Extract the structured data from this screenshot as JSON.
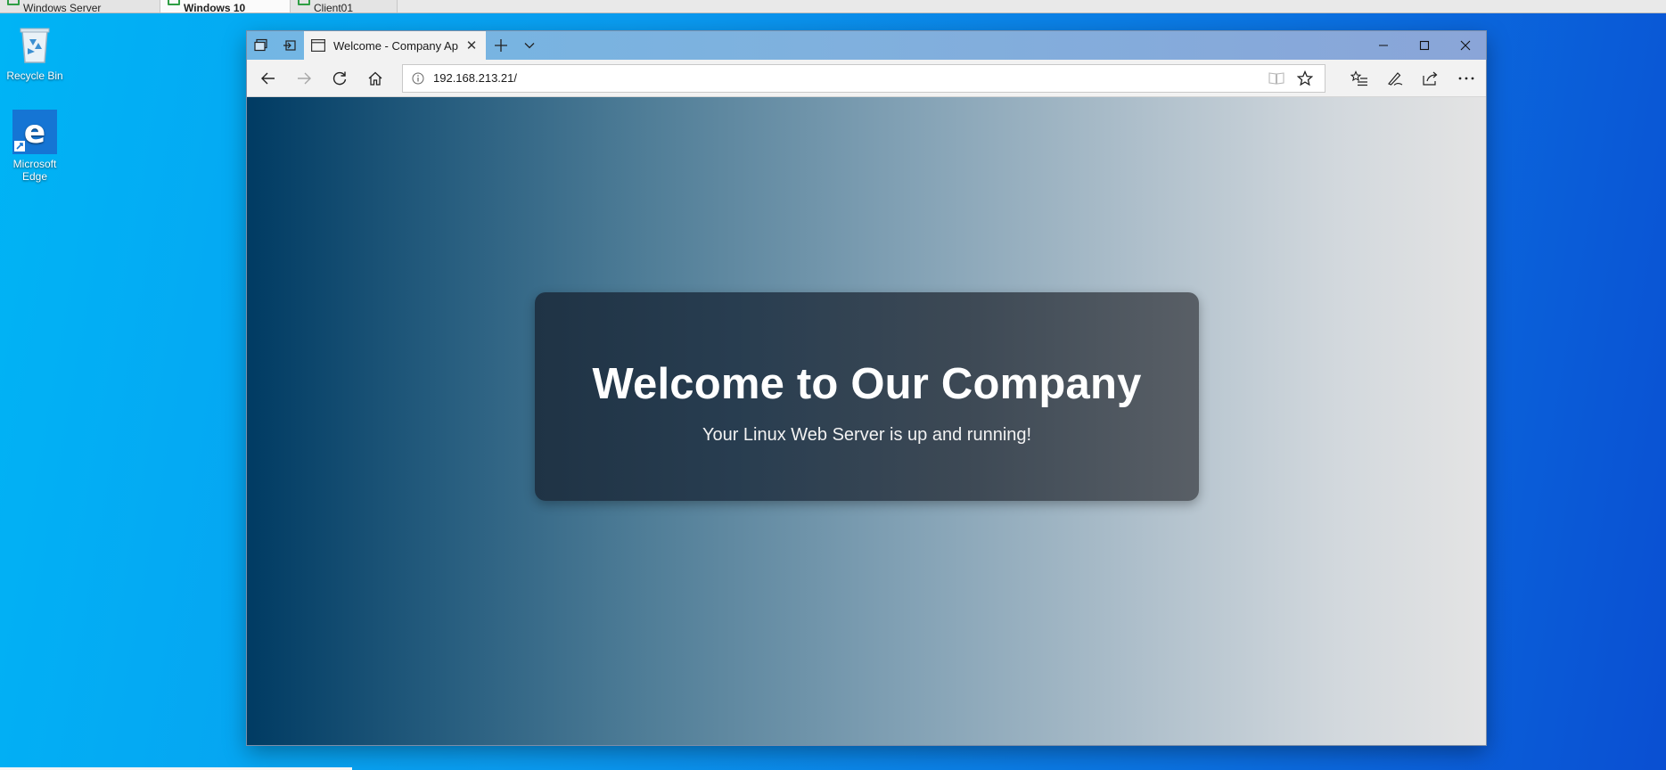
{
  "vm_tabs": [
    {
      "label": "Windows Server",
      "active": false
    },
    {
      "label": "Windows 10",
      "active": true
    },
    {
      "label": "Client01",
      "active": false
    }
  ],
  "desktop": {
    "icons": [
      {
        "label": "Recycle Bin",
        "icon": "recycle-bin-icon"
      },
      {
        "label": "Microsoft Edge",
        "icon": "edge-icon"
      }
    ]
  },
  "browser": {
    "tab_title": "Welcome - Company Ap",
    "address": "192.168.213.21/"
  },
  "page": {
    "heading": "Welcome to Our Company",
    "subheading": "Your Linux Web Server is up and running!"
  },
  "colors": {
    "desktop_accent": "#0a9cf0",
    "gradient_start": "#003b63",
    "gradient_end": "#e4e4e4",
    "card_bg": "#283d50"
  }
}
